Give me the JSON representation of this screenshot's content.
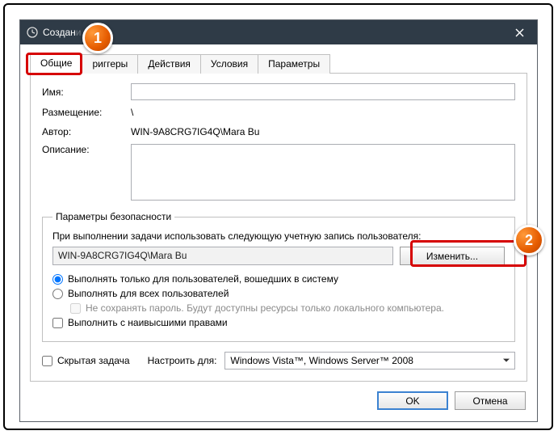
{
  "window": {
    "title": "Создан",
    "title_suffix": "и"
  },
  "tabs": {
    "general": "Общие",
    "triggers": "риггеры",
    "actions": "Действия",
    "conditions": "Условия",
    "settings": "Параметры"
  },
  "labels": {
    "name": "Имя:",
    "location": "Размещение:",
    "author": "Автор:",
    "description": "Описание:",
    "security_group": "Параметры безопасности",
    "security_caption": "При выполнении задачи использовать следующую учетную запись пользователя:",
    "change": "Изменить...",
    "radio_logged": "Выполнять только для пользователей, вошедших в систему",
    "radio_all": "Выполнять для всех пользователей",
    "save_pw": "Не сохранять пароль. Будут доступны ресурсы только локального компьютера.",
    "highest": "Выполнить с наивысшими правами",
    "hidden": "Скрытая задача",
    "configure_for": "Настроить для:",
    "ok": "OK",
    "cancel": "Отмена"
  },
  "values": {
    "name": "",
    "location": "\\",
    "author": "WIN-9A8CRG7IG4Q\\Mara Bu",
    "description": "",
    "account": "WIN-9A8CRG7IG4Q\\Mara Bu",
    "compat": "Windows Vista™, Windows Server™ 2008"
  },
  "callouts": {
    "one": "1",
    "two": "2"
  }
}
